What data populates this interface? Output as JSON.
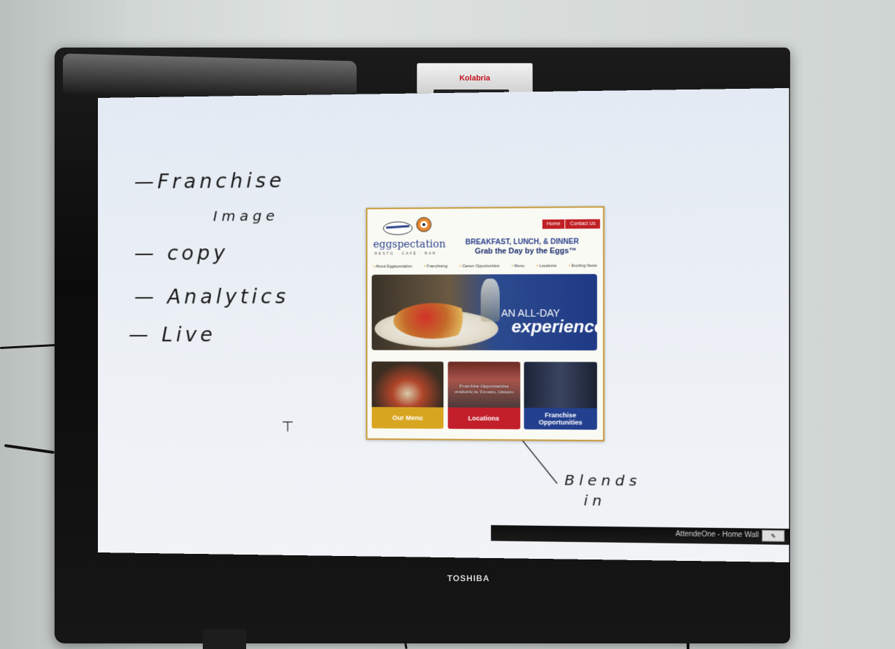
{
  "device": {
    "camera_label": "Kolabria",
    "tv_brand": "TOSHIBA"
  },
  "whiteboard": {
    "notes": [
      "—Franchise",
      "Image",
      "— copy",
      "— Analytics",
      "— Live"
    ],
    "annotation": [
      "Blends",
      "in"
    ]
  },
  "website": {
    "logo": "eggspectation",
    "logo_sub": "RESTO · CAFÉ · BAR",
    "top_nav": [
      "Home",
      "Contact Us"
    ],
    "tagline_line1": "BREAKFAST, LUNCH, & DINNER",
    "tagline_line2": "Grab the Day by the Eggs™",
    "sub_nav": [
      "About Eggspectation",
      "Franchising",
      "Career Opportunities",
      "Menu",
      "Locations",
      "Exciting News"
    ],
    "hero_line1": "AN ALL-DAY",
    "hero_line2": "experience",
    "cards": [
      {
        "label": "Our Menu",
        "color": "#d8a521"
      },
      {
        "label": "Locations",
        "overlay": "Franchise Opportunities available in Toronto, Ontario",
        "color": "#c21f2a"
      },
      {
        "label": "Franchise Opportunities",
        "color": "#233f8f"
      }
    ]
  },
  "statusbar": {
    "title": "AttendeOne - Home Wall"
  },
  "colors": {
    "bezel": "#111111",
    "screen": "#eaeff4",
    "accent_red": "#c01f24",
    "accent_blue": "#2a3f8a"
  }
}
